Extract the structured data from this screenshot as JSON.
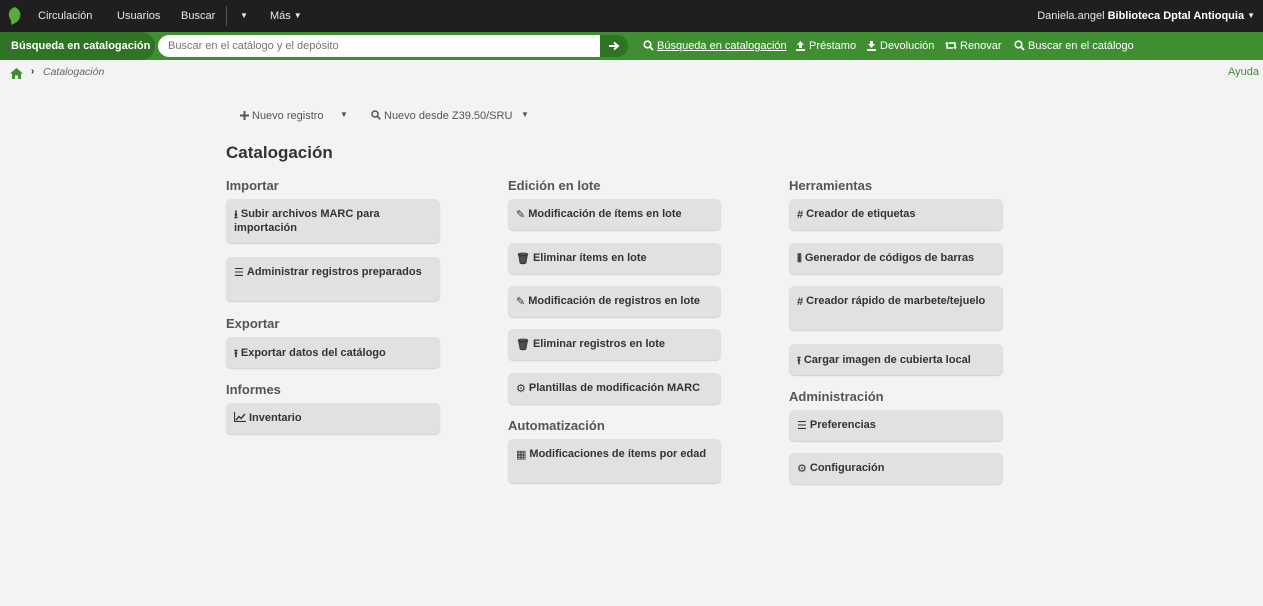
{
  "topnav": {
    "items": [
      "Circulación",
      "Usuarios",
      "Buscar",
      "Más"
    ],
    "user_name": "Daniela.angel",
    "library": "Biblioteca Dptal Antioquia"
  },
  "search": {
    "label": "Búsqueda en catalogación",
    "placeholder": "Buscar en el catálogo y el depósito",
    "quick_links": [
      "Búsqueda en catalogación",
      "Préstamo",
      "Devolución",
      "Renovar",
      "Buscar en el catálogo"
    ]
  },
  "breadcrumb": {
    "current": "Catalogación"
  },
  "help": "Ayuda",
  "toolbar": {
    "new_record": "Nuevo registro",
    "new_z3950": "Nuevo desde Z39.50/SRU"
  },
  "page_title": "Catalogación",
  "sections": {
    "importar": "Importar",
    "exportar": "Exportar",
    "informes": "Informes",
    "edicion": "Edición en lote",
    "automatizacion": "Automatización",
    "herramientas": "Herramientas",
    "administracion": "Administración"
  },
  "buttons": {
    "upload_marc": "Subir archivos MARC para importación",
    "manage_staged": "Administrar registros preparados",
    "export_catalog": "Exportar datos del catálogo",
    "inventory": "Inventario",
    "batch_item_mod": "Modificación de ítems en lote",
    "batch_item_del": "Eliminar ítems en lote",
    "batch_record_mod": "Modificación de registros en lote",
    "batch_record_del": "Eliminar registros en lote",
    "marc_templates": "Plantillas de modificación MARC",
    "age_item_mod": "Modificaciones de ítems por edad",
    "label_creator": "Creador de etiquetas",
    "barcode_gen": "Generador de códigos de barras",
    "spine_label": "Creador rápido de marbete/tejuelo",
    "cover_upload": "Cargar imagen de cubierta local",
    "preferences": "Preferencias",
    "configuration": "Configuración"
  },
  "colors": {
    "topbar": "#1f1f1f",
    "green": "#3f8f32",
    "dark_green": "#2f7424",
    "button": "#e1e1e1",
    "background": "#f3f3f3"
  }
}
